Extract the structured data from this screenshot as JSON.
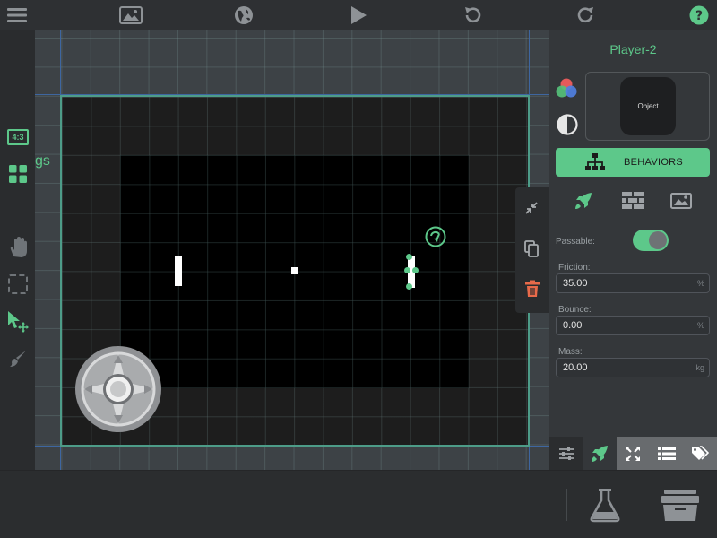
{
  "toolbar": {
    "menu": "menu-icon",
    "scene": "image-icon",
    "world": "globe-icon",
    "play": "play-icon",
    "undo": "undo-icon",
    "redo": "redo-icon",
    "help": "help-icon"
  },
  "leftbar": {
    "aspect_label": "4:3",
    "tools": [
      "aspect-ratio-icon",
      "grid-icon",
      "hand-icon",
      "select-box-icon",
      "pointer-icon",
      "brush-icon"
    ]
  },
  "canvas": {
    "partial_text": "gs"
  },
  "floating_tools": [
    "collapse-icon",
    "copy-icon",
    "trash-icon"
  ],
  "panel": {
    "title": "Player-2",
    "preview_label": "Object",
    "behaviors_label": "BEHAVIORS",
    "passable_label": "Passable:",
    "passable_on": true,
    "friction_label": "Friction:",
    "friction_value": "35.00",
    "friction_unit": "%",
    "bounce_label": "Bounce:",
    "bounce_value": "0.00",
    "bounce_unit": "%",
    "mass_label": "Mass:",
    "mass_value": "20.00",
    "mass_unit": "kg"
  },
  "bottom_tabs": [
    "sliders-icon",
    "rocket-icon",
    "expand-icon",
    "list-icon",
    "tags-icon"
  ],
  "bottom_actions": [
    "flask-icon",
    "archive-icon"
  ],
  "colors": {
    "accent": "#5dc88a",
    "danger": "#e86a4a",
    "scene_border": "#4d9c88"
  }
}
